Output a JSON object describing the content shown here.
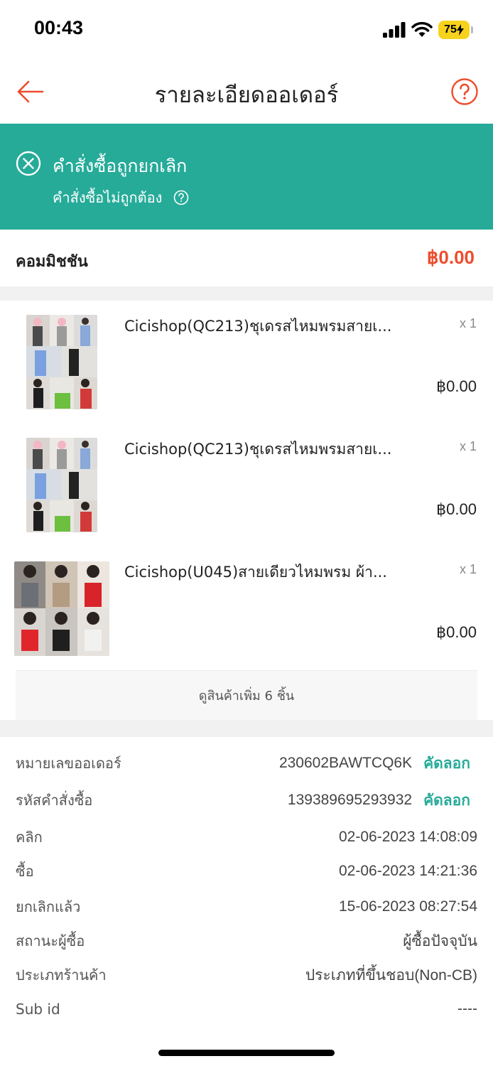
{
  "status_bar": {
    "time": "00:43",
    "battery": "75"
  },
  "header": {
    "title": "รายละเอียดออเดอร์",
    "accent_color": "#ee4d2d"
  },
  "banner": {
    "title": "คำสั่งซื้อถูกยกเลิก",
    "subtitle": "คำสั่งซื้อไม่ถูกต้อง",
    "background_color": "#26ab99"
  },
  "commission": {
    "label": "คอมมิชชัน",
    "value": "฿0.00"
  },
  "products": [
    {
      "name": "Cicishop(QC213)ชุเดรสไหมพรมสายเ...",
      "qty": "x 1",
      "price": "฿0.00"
    },
    {
      "name": "Cicishop(QC213)ชุเดรสไหมพรมสายเ...",
      "qty": "x 1",
      "price": "฿0.00"
    },
    {
      "name": "Cicishop(U045)สายเดียวไหมพรม ผ้า...",
      "qty": "x 1",
      "price": "฿0.00"
    }
  ],
  "more_products": "ดูสินค้าเพิ่ม 6 ชิ้น",
  "details": {
    "order_number": {
      "label": "หมายเลขออเดอร์",
      "value": "230602BAWTCQ6K",
      "copy": "คัดลอก"
    },
    "purchase_id": {
      "label": "รหัสคำสั่งซื้อ",
      "value": "139389695293932",
      "copy": "คัดลอก"
    },
    "click": {
      "label": "คลิก",
      "value": "02-06-2023 14:08:09"
    },
    "buy": {
      "label": "ซื้อ",
      "value": "02-06-2023 14:21:36"
    },
    "cancelled": {
      "label": "ยกเลิกแล้ว",
      "value": "15-06-2023 08:27:54"
    },
    "buyer_status": {
      "label": "สถานะผู้ซื้อ",
      "value": "ผู้ซื้อปัจจุบัน"
    },
    "shop_type": {
      "label": "ประเภทร้านค้า",
      "value": "ประเภทที่ขึ้นชอบ(Non-CB)"
    },
    "sub_id": {
      "label": "Sub id",
      "value": "----"
    }
  }
}
